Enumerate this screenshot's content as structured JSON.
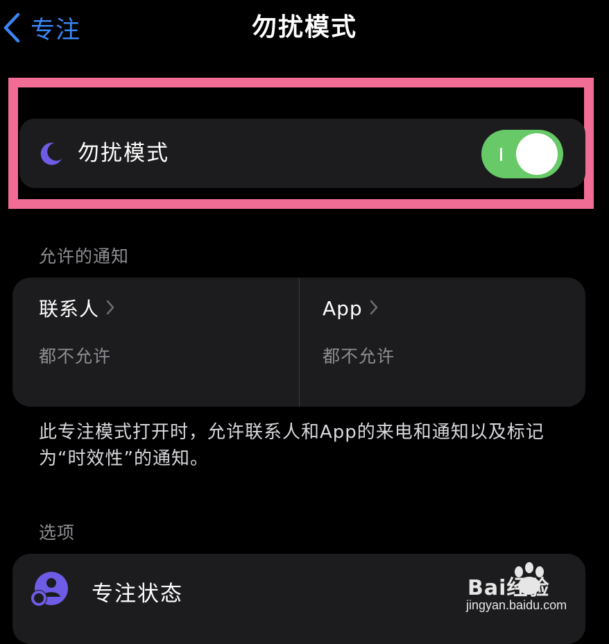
{
  "nav": {
    "back_label": "专注",
    "title": "勿扰模式"
  },
  "dnd_row": {
    "label": "勿扰模式",
    "toggle_on": true,
    "toggle_color": "#67c967",
    "icon": "moon-icon",
    "icon_color": "#6e5ce6"
  },
  "highlight_color": "#f26d96",
  "allowed_notifications": {
    "header": "允许的通知",
    "people": {
      "title": "联系人",
      "subtitle": "都不允许"
    },
    "apps": {
      "title": "App",
      "subtitle": "都不允许"
    },
    "footnote": "此专注模式打开时，允许联系人和App的来电和通知以及标记为“时效性”的通知。"
  },
  "options": {
    "header": "选项",
    "focus_status": {
      "label": "专注状态",
      "icon": "person-circle-icon",
      "icon_color": "#6e5ce6"
    }
  },
  "watermark": {
    "brand": "Bai经验",
    "url": "jingyan.baidu.com"
  }
}
